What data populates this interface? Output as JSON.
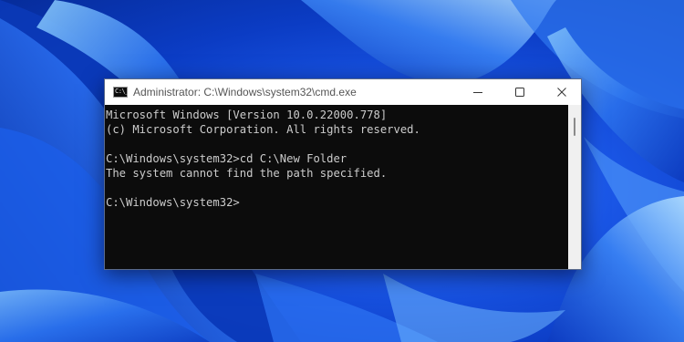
{
  "desktop": {
    "accent": "#1a56e6"
  },
  "window": {
    "title": "Administrator: C:\\Windows\\system32\\cmd.exe",
    "icon": "cmd-icon",
    "icon_glyph": "C:\\_",
    "buttons": {
      "minimize": "minimize-icon",
      "maximize": "maximize-icon",
      "close": "close-icon"
    }
  },
  "console": {
    "background": "#0c0c0c",
    "foreground": "#cccccc",
    "lines": [
      "Microsoft Windows [Version 10.0.22000.778]",
      "(c) Microsoft Corporation. All rights reserved.",
      "",
      "C:\\Windows\\system32>cd C:\\New Folder",
      "The system cannot find the path specified.",
      "",
      "C:\\Windows\\system32>"
    ]
  }
}
